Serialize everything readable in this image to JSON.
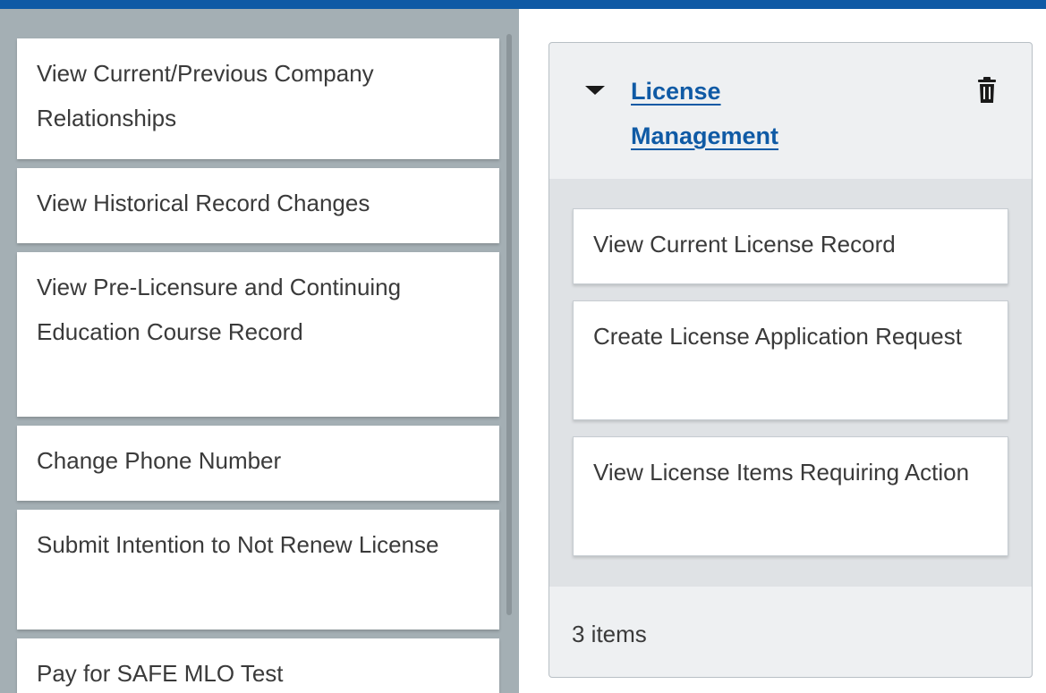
{
  "left_cards": [
    {
      "label": "View Current/Previous Company Relationships"
    },
    {
      "label": "View Historical Record Changes"
    },
    {
      "label": "View Pre-Licensure and Continuing Education Course Record"
    },
    {
      "label": "Change Phone Number"
    },
    {
      "label": "Submit Intention to Not Renew License"
    },
    {
      "label": "Pay for SAFE MLO Test"
    }
  ],
  "group": {
    "title": "License Management",
    "items": [
      {
        "label": "View Current License Record"
      },
      {
        "label": "Create License Application Request"
      },
      {
        "label": "View License Items Requiring Action"
      }
    ],
    "count_label": "3 items"
  },
  "icons": {
    "collapse": "caret-down-icon",
    "delete": "trash-icon"
  },
  "colors": {
    "accent": "#0f5aa5",
    "left_panel_bg": "#a4afb4"
  }
}
